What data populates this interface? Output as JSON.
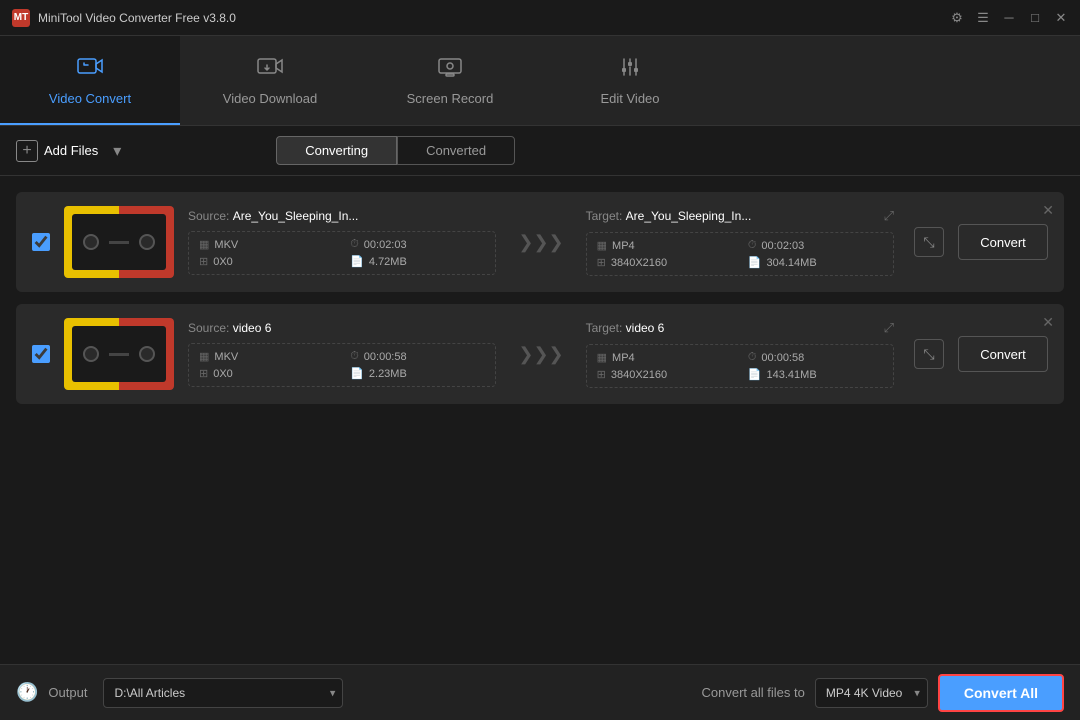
{
  "app": {
    "title": "MiniTool Video Converter Free v3.8.0",
    "icon": "MT"
  },
  "titlebar": {
    "controls": {
      "settings": "⚙",
      "menu": "☰",
      "minimize": "─",
      "maximize": "□",
      "close": "✕"
    }
  },
  "nav": {
    "tabs": [
      {
        "id": "video-convert",
        "label": "Video Convert",
        "icon": "📼",
        "active": true
      },
      {
        "id": "video-download",
        "label": "Video Download",
        "icon": "⬇"
      },
      {
        "id": "screen-record",
        "label": "Screen Record",
        "icon": "🎬"
      },
      {
        "id": "edit-video",
        "label": "Edit Video",
        "icon": "✂"
      }
    ]
  },
  "toolbar": {
    "add_files_label": "Add Files",
    "converting_label": "Converting",
    "converted_label": "Converted"
  },
  "files": [
    {
      "id": "file1",
      "source_label": "Source:",
      "source_name": "Are_You_Sleeping_In...",
      "source_format": "MKV",
      "source_duration": "00:02:03",
      "source_resolution": "0X0",
      "source_size": "4.72MB",
      "target_label": "Target:",
      "target_name": "Are_You_Sleeping_In...",
      "target_format": "MP4",
      "target_duration": "00:02:03",
      "target_resolution": "3840X2160",
      "target_size": "304.14MB",
      "convert_btn": "Convert"
    },
    {
      "id": "file2",
      "source_label": "Source:",
      "source_name": "video 6",
      "source_format": "MKV",
      "source_duration": "00:00:58",
      "source_resolution": "0X0",
      "source_size": "2.23MB",
      "target_label": "Target:",
      "target_name": "video 6",
      "target_format": "MP4",
      "target_duration": "00:00:58",
      "target_resolution": "3840X2160",
      "target_size": "143.41MB",
      "convert_btn": "Convert"
    }
  ],
  "bottom": {
    "output_icon": "🕐",
    "output_label": "Output",
    "output_path": "D:\\All Articles",
    "convert_all_label": "Convert all files to",
    "format_option": "MP4 4K Video",
    "convert_all_btn": "Convert All"
  }
}
